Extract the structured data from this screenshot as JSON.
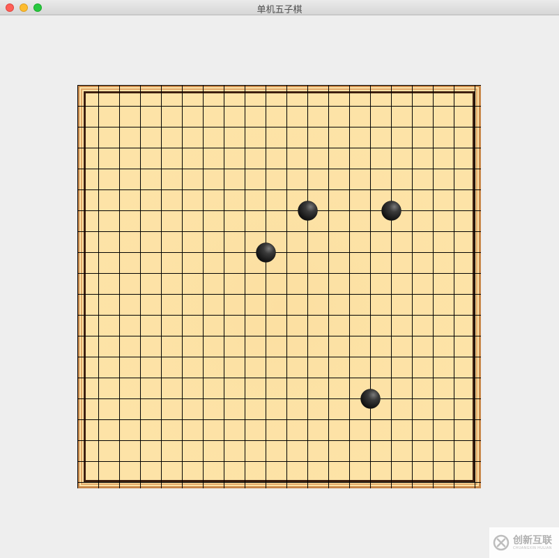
{
  "window": {
    "title": "单机五子棋"
  },
  "board": {
    "size": 19,
    "background_color": "#fde3a7",
    "line_color": "#000000",
    "frame_color": "#c8874a",
    "frame_dark": "#3d1f0f",
    "stones": [
      {
        "col": 11,
        "row": 6,
        "color": "black"
      },
      {
        "col": 15,
        "row": 6,
        "color": "black"
      },
      {
        "col": 9,
        "row": 8,
        "color": "black"
      },
      {
        "col": 14,
        "row": 15,
        "color": "black"
      }
    ]
  },
  "watermark": {
    "text": "创新互联",
    "subtext": "CHUANGXIN HULIAN",
    "icon": "chuangxin-logo-icon"
  }
}
